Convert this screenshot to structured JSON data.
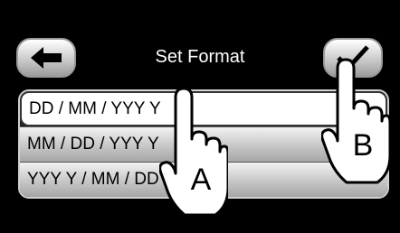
{
  "screen": {
    "title": "Set Format",
    "back_icon": "left-arrow-icon",
    "confirm_icon": "checkmark-icon"
  },
  "formats": [
    {
      "label": "DD / MM / YYY Y",
      "selected": true
    },
    {
      "label": "MM / DD / YYY Y",
      "selected": false
    },
    {
      "label": "YYY Y / MM / DD",
      "selected": false
    }
  ],
  "callouts": {
    "a": "A",
    "b": "B"
  }
}
